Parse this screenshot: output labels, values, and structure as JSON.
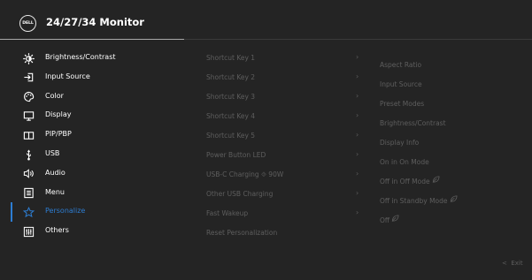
{
  "header": {
    "title": "24/27/34 Monitor",
    "logo_text": "DELL"
  },
  "menu": [
    {
      "label": "Brightness/Contrast",
      "icon": "brightness-icon",
      "active": false
    },
    {
      "label": "Input Source",
      "icon": "input-source-icon",
      "active": false
    },
    {
      "label": "Color",
      "icon": "color-palette-icon",
      "active": false
    },
    {
      "label": "Display",
      "icon": "display-icon",
      "active": false
    },
    {
      "label": "PIP/PBP",
      "icon": "pip-pbp-icon",
      "active": false
    },
    {
      "label": "USB",
      "icon": "usb-icon",
      "active": false
    },
    {
      "label": "Audio",
      "icon": "audio-icon",
      "active": false
    },
    {
      "label": "Menu",
      "icon": "menu-icon",
      "active": false
    },
    {
      "label": "Personalize",
      "icon": "star-icon",
      "active": true
    },
    {
      "label": "Others",
      "icon": "others-icon",
      "active": false
    }
  ],
  "submenu": [
    {
      "label": "Shortcut Key 1",
      "chevron": true
    },
    {
      "label": "Shortcut Key 2",
      "chevron": true
    },
    {
      "label": "Shortcut Key 3",
      "chevron": true
    },
    {
      "label": "Shortcut Key 4",
      "chevron": true
    },
    {
      "label": "Shortcut Key 5",
      "chevron": true
    },
    {
      "label": "Power Button LED",
      "chevron": true
    },
    {
      "label": "USB-C Charging ⯑ 90W",
      "chevron": true
    },
    {
      "label": "Other USB Charging",
      "chevron": true
    },
    {
      "label": "Fast Wakeup",
      "chevron": true
    },
    {
      "label": "Reset Personalization",
      "chevron": false
    }
  ],
  "values": [
    {
      "label": "Aspect Ratio",
      "leaf": false
    },
    {
      "label": "Input Source",
      "leaf": false
    },
    {
      "label": "Preset Modes",
      "leaf": false
    },
    {
      "label": "Brightness/Contrast",
      "leaf": false
    },
    {
      "label": "Display Info",
      "leaf": false
    },
    {
      "label": "On in On Mode",
      "leaf": false
    },
    {
      "label": "Off in Off Mode",
      "leaf": true
    },
    {
      "label": "Off in Standby Mode",
      "leaf": true
    },
    {
      "label": "Off",
      "leaf": true
    }
  ],
  "footer": {
    "exit_label": "Exit",
    "exit_icon": "chevron-left-icon"
  },
  "colors": {
    "background": "#242424",
    "accent": "#2d7dd2",
    "dim_text": "#5e5e5e",
    "text": "#ffffff"
  }
}
